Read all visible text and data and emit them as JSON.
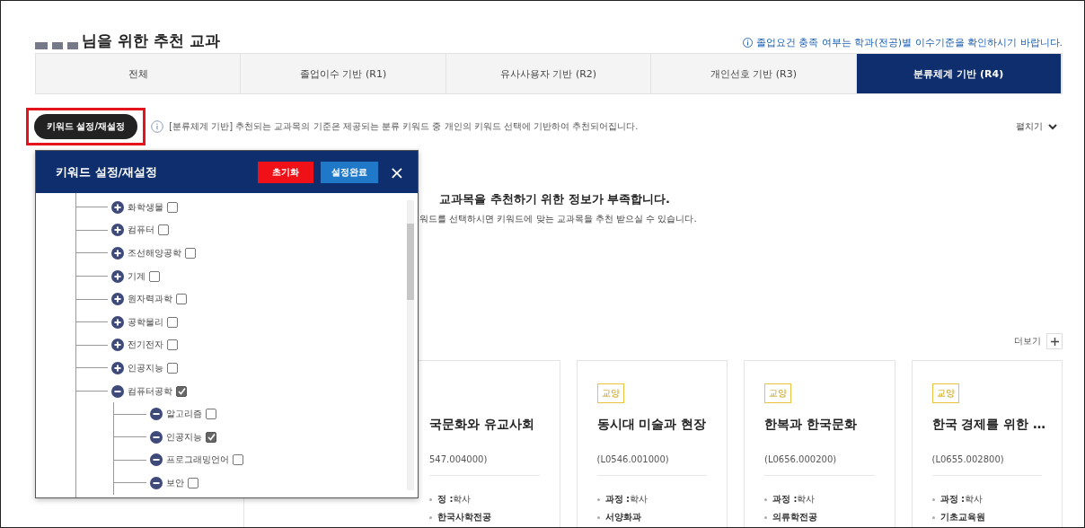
{
  "header": {
    "title": "님을 위한 추천 교과",
    "notice": "졸업요건 충족 여부는 학과(전공)별 이수기준을 확인하시기 바랍니다."
  },
  "tabs": [
    {
      "label": "전체",
      "selected": false
    },
    {
      "label": "졸업이수 기반 (R1)",
      "selected": false
    },
    {
      "label": "유사사용자 기반 (R2)",
      "selected": false
    },
    {
      "label": "개인선호 기반 (R3)",
      "selected": false
    },
    {
      "label": "분류체계 기반 (R4)",
      "selected": true
    }
  ],
  "toolbar": {
    "keyword_button": "키워드 설정/재설정",
    "info": "[분류체계 기반] 추천되는 교과목의 기준은 제공되는 분류 키워드 중 개인의 키워드 선택에 기반하여 추천되어집니다.",
    "expand": "펼치기"
  },
  "message": {
    "title": "교과목을 추천하기 위한 정보가 부족합니다.",
    "detail": "워드를 선택하시면 키워드에 맞는 교과목을 추천 받으실 수 있습니다."
  },
  "more": "더보기",
  "cards": [
    {
      "title": "국문화와 유교사회",
      "code": "547.004000)",
      "items": [
        {
          "label": "정 :",
          "value": "학사"
        },
        {
          "value": "한국사학전공"
        }
      ]
    },
    {
      "badge": "교양",
      "title": "동시대 미술과 현장",
      "code": "(L0546.001000)",
      "items": [
        {
          "label": "과정 :",
          "value": "학사"
        },
        {
          "value": "서양화과"
        }
      ]
    },
    {
      "badge": "교양",
      "title": "한복과 한국문화",
      "code": "(L0656.000200)",
      "items": [
        {
          "label": "과정 :",
          "value": "학사"
        },
        {
          "value": "의류학전공"
        }
      ]
    },
    {
      "badge": "교양",
      "title": "한국 경제를 위한 …",
      "code": "(L0655.002800)",
      "items": [
        {
          "label": "과정 :",
          "value": "학사"
        },
        {
          "value": "기초교육원"
        }
      ]
    }
  ],
  "popup": {
    "title": "키워드 설정/재설정",
    "reset_button": "초기화",
    "done_button": "설정완료",
    "close": "×",
    "tree": [
      {
        "label": "화학생물",
        "checked": false,
        "expanded": false
      },
      {
        "label": "컴퓨터",
        "checked": false,
        "expanded": false
      },
      {
        "label": "조선해양공학",
        "checked": false,
        "expanded": false
      },
      {
        "label": "기계",
        "checked": false,
        "expanded": false
      },
      {
        "label": "원자력과학",
        "checked": false,
        "expanded": false
      },
      {
        "label": "공학물리",
        "checked": false,
        "expanded": false
      },
      {
        "label": "전기전자",
        "checked": false,
        "expanded": false
      },
      {
        "label": "인공지능",
        "checked": false,
        "expanded": false
      },
      {
        "label": "컴퓨터공학",
        "checked": true,
        "expanded": true,
        "children": [
          {
            "label": "알고리즘",
            "checked": false,
            "expanded": true
          },
          {
            "label": "인공지능",
            "checked": true,
            "expanded": true
          },
          {
            "label": "프로그래밍언어",
            "checked": false,
            "expanded": true
          },
          {
            "label": "보안",
            "checked": false,
            "expanded": true
          }
        ]
      }
    ]
  }
}
